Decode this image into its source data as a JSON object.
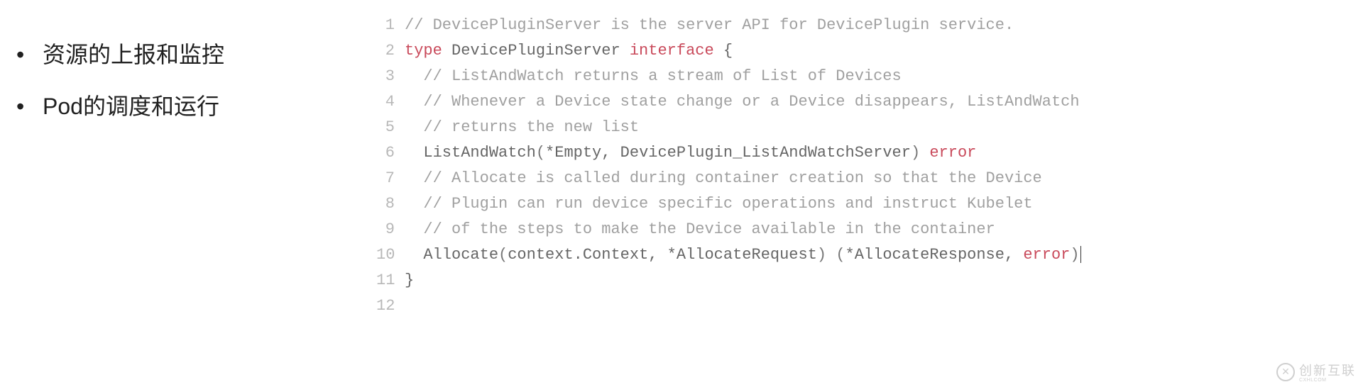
{
  "left": {
    "bullets": [
      "资源的上报和监控",
      "Pod的调度和运行"
    ]
  },
  "code": {
    "lines": [
      {
        "n": "1",
        "tokens": [
          {
            "t": "// DevicePluginServer is the server API for DevicePlugin service.",
            "c": "c-comment"
          }
        ]
      },
      {
        "n": "2",
        "tokens": [
          {
            "t": "type",
            "c": "c-keyword"
          },
          {
            "t": " ",
            "c": "c-punc"
          },
          {
            "t": "DevicePluginServer",
            "c": "c-ident"
          },
          {
            "t": " ",
            "c": "c-punc"
          },
          {
            "t": "interface",
            "c": "c-keyword"
          },
          {
            "t": " ",
            "c": "c-punc"
          },
          {
            "t": "{",
            "c": "c-punc"
          }
        ]
      },
      {
        "n": "3",
        "tokens": [
          {
            "t": "  // ListAndWatch returns a stream of List of Devices",
            "c": "c-comment"
          }
        ]
      },
      {
        "n": "4",
        "tokens": [
          {
            "t": "  // Whenever a Device state change or a Device disappears, ListAndWatch",
            "c": "c-comment"
          }
        ]
      },
      {
        "n": "5",
        "tokens": [
          {
            "t": "  // returns the new list",
            "c": "c-comment"
          }
        ]
      },
      {
        "n": "6",
        "tokens": [
          {
            "t": "  ",
            "c": "c-punc"
          },
          {
            "t": "ListAndWatch",
            "c": "c-ident"
          },
          {
            "t": "(",
            "c": "c-paren"
          },
          {
            "t": "*Empty, DevicePlugin_ListAndWatchServer",
            "c": "c-type"
          },
          {
            "t": ")",
            "c": "c-paren"
          },
          {
            "t": " ",
            "c": "c-punc"
          },
          {
            "t": "error",
            "c": "c-error"
          }
        ]
      },
      {
        "n": "7",
        "tokens": [
          {
            "t": "  // Allocate is called during container creation so that the Device",
            "c": "c-comment"
          }
        ]
      },
      {
        "n": "8",
        "tokens": [
          {
            "t": "  // Plugin can run device specific operations and instruct Kubelet",
            "c": "c-comment"
          }
        ]
      },
      {
        "n": "9",
        "tokens": [
          {
            "t": "  // of the steps to make the Device available in the container",
            "c": "c-comment"
          }
        ]
      },
      {
        "n": "10",
        "tokens": [
          {
            "t": "  ",
            "c": "c-punc"
          },
          {
            "t": "Allocate",
            "c": "c-ident"
          },
          {
            "t": "(",
            "c": "c-paren"
          },
          {
            "t": "context.Context, *AllocateRequest",
            "c": "c-type"
          },
          {
            "t": ")",
            "c": "c-paren"
          },
          {
            "t": " ",
            "c": "c-punc"
          },
          {
            "t": "(",
            "c": "c-paren"
          },
          {
            "t": "*AllocateResponse, ",
            "c": "c-type"
          },
          {
            "t": "error",
            "c": "c-error"
          },
          {
            "t": ")",
            "c": "c-paren"
          }
        ],
        "cursor": true
      },
      {
        "n": "11",
        "tokens": [
          {
            "t": "}",
            "c": "c-punc"
          }
        ]
      },
      {
        "n": "12",
        "tokens": [
          {
            "t": "",
            "c": "c-punc"
          }
        ]
      }
    ]
  },
  "watermark": {
    "icon": "✕",
    "text": "创新互联",
    "sub": "CXHLCOM"
  }
}
